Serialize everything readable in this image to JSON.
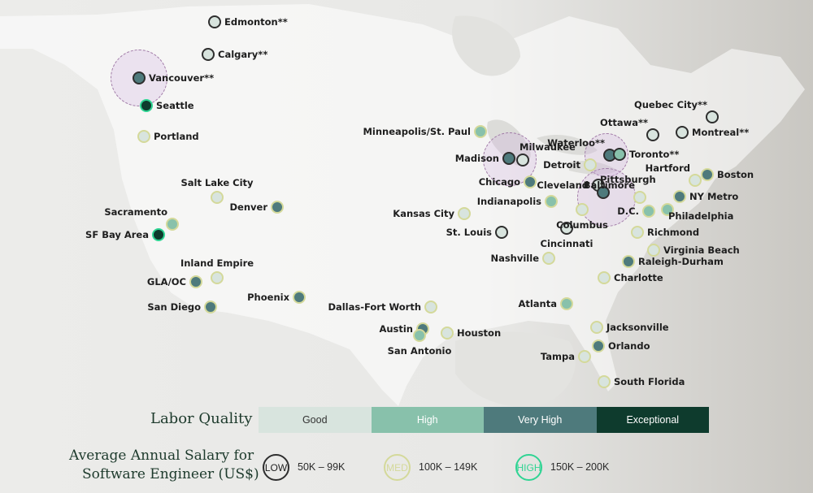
{
  "legend": {
    "labor_title": "Labor Quality",
    "labor_levels": [
      {
        "label": "Good",
        "color": "#d8e4de",
        "text": "#333333"
      },
      {
        "label": "High",
        "color": "#88c1ab",
        "text": "#ffffff"
      },
      {
        "label": "Very High",
        "color": "#4e7a7c",
        "text": "#ffffff"
      },
      {
        "label": "Exceptional",
        "color": "#0e3b2d",
        "text": "#ffffff"
      }
    ],
    "salary_title_line1": "Average Annual Salary for",
    "salary_title_line2": "Software Engineer (US$)",
    "salary_levels": [
      {
        "tag": "LOW",
        "range": "50K – 99K",
        "color": "#2e2e2e"
      },
      {
        "tag": "MED",
        "range": "100K – 149K",
        "color": "#d4d99a"
      },
      {
        "tag": "HIGH",
        "range": "150K – 200K",
        "color": "#2fd493"
      }
    ]
  },
  "colors": {
    "fill": {
      "good": "#d8e4de",
      "high": "#88c1ab",
      "veryhigh": "#4e7a7c",
      "exceptional": "#0e3b2d"
    },
    "ring": {
      "low": "#2e2e2e",
      "med": "#d4d99a",
      "high": "#2fd493"
    }
  },
  "cities": [
    {
      "name": "Edmonton**",
      "labor": "good",
      "salary": "low"
    },
    {
      "name": "Calgary**",
      "labor": "good",
      "salary": "low"
    },
    {
      "name": "Vancouver**",
      "labor": "veryhigh",
      "salary": "low"
    },
    {
      "name": "Seattle",
      "labor": "exceptional",
      "salary": "high"
    },
    {
      "name": "Portland",
      "labor": "good",
      "salary": "med"
    },
    {
      "name": "Salt Lake City",
      "labor": "good",
      "salary": "med"
    },
    {
      "name": "Denver",
      "labor": "veryhigh",
      "salary": "med"
    },
    {
      "name": "Sacramento",
      "labor": "high",
      "salary": "med"
    },
    {
      "name": "SF Bay Area",
      "labor": "exceptional",
      "salary": "high"
    },
    {
      "name": "Inland Empire",
      "labor": "good",
      "salary": "med"
    },
    {
      "name": "GLA/OC",
      "labor": "veryhigh",
      "salary": "med"
    },
    {
      "name": "San Diego",
      "labor": "veryhigh",
      "salary": "med"
    },
    {
      "name": "Phoenix",
      "labor": "veryhigh",
      "salary": "med"
    },
    {
      "name": "Minneapolis/St. Paul",
      "labor": "high",
      "salary": "med"
    },
    {
      "name": "Madison",
      "labor": "veryhigh",
      "salary": "low"
    },
    {
      "name": "Milwaukee",
      "labor": "good",
      "salary": "low"
    },
    {
      "name": "Chicago",
      "labor": "veryhigh",
      "salary": "med"
    },
    {
      "name": "Kansas City",
      "labor": "good",
      "salary": "med"
    },
    {
      "name": "St. Louis",
      "labor": "good",
      "salary": "low"
    },
    {
      "name": "Indianapolis",
      "labor": "high",
      "salary": "med"
    },
    {
      "name": "Dallas-Fort Worth",
      "labor": "good",
      "salary": "med"
    },
    {
      "name": "Austin",
      "labor": "veryhigh",
      "salary": "med"
    },
    {
      "name": "San Antonio",
      "labor": "high",
      "salary": "med"
    },
    {
      "name": "Houston",
      "labor": "good",
      "salary": "med"
    },
    {
      "name": "Nashville",
      "labor": "good",
      "salary": "med"
    },
    {
      "name": "Atlanta",
      "labor": "high",
      "salary": "med"
    },
    {
      "name": "Detroit",
      "labor": "good",
      "salary": "med"
    },
    {
      "name": "Cleveland",
      "labor": "good",
      "salary": "low"
    },
    {
      "name": "Pittsburgh",
      "labor": "veryhigh",
      "salary": "low"
    },
    {
      "name": "Columbus",
      "labor": "good",
      "salary": "med"
    },
    {
      "name": "Cincinnati",
      "labor": "good",
      "salary": "low"
    },
    {
      "name": "Waterloo**",
      "labor": "veryhigh",
      "salary": "low"
    },
    {
      "name": "Toronto**",
      "labor": "high",
      "salary": "low"
    },
    {
      "name": "Ottawa**",
      "labor": "good",
      "salary": "low"
    },
    {
      "name": "Montreal**",
      "labor": "good",
      "salary": "low"
    },
    {
      "name": "Quebec City**",
      "labor": "good",
      "salary": "low"
    },
    {
      "name": "Hartford",
      "labor": "good",
      "salary": "med"
    },
    {
      "name": "Boston",
      "labor": "veryhigh",
      "salary": "med"
    },
    {
      "name": "NY Metro",
      "labor": "veryhigh",
      "salary": "med"
    },
    {
      "name": "Baltimore",
      "labor": "good",
      "salary": "med"
    },
    {
      "name": "D.C.",
      "labor": "high",
      "salary": "med"
    },
    {
      "name": "Philadelphia",
      "labor": "high",
      "salary": "med"
    },
    {
      "name": "Richmond",
      "labor": "good",
      "salary": "med"
    },
    {
      "name": "Virginia Beach",
      "labor": "good",
      "salary": "med"
    },
    {
      "name": "Raleigh-Durham",
      "labor": "veryhigh",
      "salary": "med"
    },
    {
      "name": "Charlotte",
      "labor": "good",
      "salary": "med"
    },
    {
      "name": "Jacksonville",
      "labor": "good",
      "salary": "med"
    },
    {
      "name": "Orlando",
      "labor": "veryhigh",
      "salary": "med"
    },
    {
      "name": "Tampa",
      "labor": "good",
      "salary": "med"
    },
    {
      "name": "South Florida",
      "labor": "good",
      "salary": "med"
    }
  ]
}
